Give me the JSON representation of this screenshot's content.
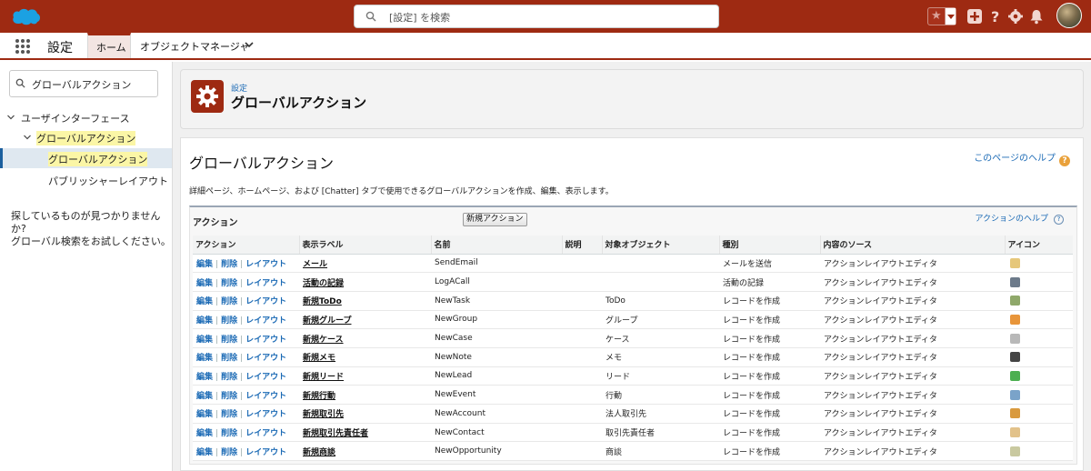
{
  "header": {
    "search_placeholder": "[設定] を検索",
    "colors": {
      "brand": "#9e2a12",
      "link": "#1b6ab5"
    },
    "icons": [
      "favorites-star-icon",
      "add-icon",
      "help-icon",
      "setup-gear-icon",
      "notifications-bell-icon",
      "user-avatar"
    ]
  },
  "nav": {
    "app_name": "設定",
    "tabs": [
      "ホーム",
      "オブジェクトマネージャ"
    ]
  },
  "sidebar": {
    "quick_find_value": "グローバルアクション",
    "tree": {
      "level1": "ユーザインターフェース",
      "level2": "グローバルアクション",
      "items": [
        "グローバルアクション",
        "パブリッシャーレイアウト"
      ]
    },
    "not_found_line1": "探しているものが見つかりませんか?",
    "not_found_line2": "グローバル検索をお試しください。"
  },
  "page_header": {
    "breadcrumb": "設定",
    "title": "グローバルアクション"
  },
  "main": {
    "title": "グローバルアクション",
    "help_link": "このページのヘルプ",
    "description": "詳細ページ、ホームページ、および [Chatter] タブで使用できるグローバルアクションを作成、編集、表示します。",
    "list": {
      "label": "アクション",
      "new_button": "新規アクション",
      "help_link": "アクションのヘルプ",
      "columns": [
        "アクション",
        "表示ラベル",
        "名前",
        "説明",
        "対象オブジェクト",
        "種別",
        "内容のソース",
        "アイコン"
      ],
      "row_actions": [
        "編集",
        "削除",
        "レイアウト"
      ],
      "rows": [
        {
          "label": "メール",
          "name": "SendEmail",
          "desc": "",
          "target": "",
          "type": "メールを送信",
          "source": "アクションレイアウトエディタ",
          "icon": "email-icon",
          "icon_color": "#e6c77a"
        },
        {
          "label": "活動の記録",
          "name": "LogACall",
          "desc": "",
          "target": "",
          "type": "活動の記録",
          "source": "アクションレイアウトエディタ",
          "icon": "phone-icon",
          "icon_color": "#6c7a8a"
        },
        {
          "label": "新規ToDo",
          "name": "NewTask",
          "desc": "",
          "target": "ToDo",
          "type": "レコードを作成",
          "source": "アクションレイアウトエディタ",
          "icon": "task-icon",
          "icon_color": "#8fa86a"
        },
        {
          "label": "新規グループ",
          "name": "NewGroup",
          "desc": "",
          "target": "グループ",
          "type": "レコードを作成",
          "source": "アクションレイアウトエディタ",
          "icon": "group-icon",
          "icon_color": "#e8953a"
        },
        {
          "label": "新規ケース",
          "name": "NewCase",
          "desc": "",
          "target": "ケース",
          "type": "レコードを作成",
          "source": "アクションレイアウトエディタ",
          "icon": "case-icon",
          "icon_color": "#b8b8b8"
        },
        {
          "label": "新規メモ",
          "name": "NewNote",
          "desc": "",
          "target": "メモ",
          "type": "レコードを作成",
          "source": "アクションレイアウトエディタ",
          "icon": "note-icon",
          "icon_color": "#444444"
        },
        {
          "label": "新規リード",
          "name": "NewLead",
          "desc": "",
          "target": "リード",
          "type": "レコードを作成",
          "source": "アクションレイアウトエディタ",
          "icon": "lead-icon",
          "icon_color": "#4caf50"
        },
        {
          "label": "新規行動",
          "name": "NewEvent",
          "desc": "",
          "target": "行動",
          "type": "レコードを作成",
          "source": "アクションレイアウトエディタ",
          "icon": "event-icon",
          "icon_color": "#7aa3c9"
        },
        {
          "label": "新規取引先",
          "name": "NewAccount",
          "desc": "",
          "target": "法人取引先",
          "type": "レコードを作成",
          "source": "アクションレイアウトエディタ",
          "icon": "account-icon",
          "icon_color": "#d99a3e"
        },
        {
          "label": "新規取引先責任者",
          "name": "NewContact",
          "desc": "",
          "target": "取引先責任者",
          "type": "レコードを作成",
          "source": "アクションレイアウトエディタ",
          "icon": "contact-icon",
          "icon_color": "#e2c28a"
        },
        {
          "label": "新規商談",
          "name": "NewOpportunity",
          "desc": "",
          "target": "商談",
          "type": "レコードを作成",
          "source": "アクションレイアウトエディタ",
          "icon": "opportunity-icon",
          "icon_color": "#c9c9a0"
        }
      ]
    }
  }
}
